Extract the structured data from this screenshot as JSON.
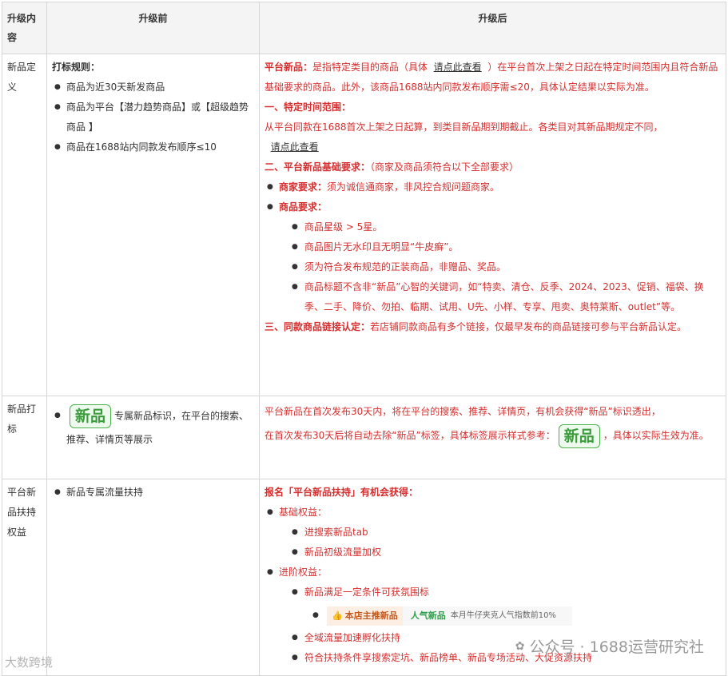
{
  "headers": [
    "升级内容",
    "升级前",
    "升级后"
  ],
  "row1": {
    "label": "新品定义",
    "before": {
      "title": "打标规则：",
      "items": [
        "商品为近30天新发商品",
        "商品为平台【潜力趋势商品】或【超级趋势商品 】",
        "商品在1688站内同款发布顺序≤10"
      ]
    },
    "after": {
      "intro_bold": "平台新品：",
      "intro_a": "是指特定类目的商品（具体",
      "intro_link": "请点此查看",
      "intro_b": "）在平台首次上架之日起在特定时间范围内且符合新品基础要求的商品。此外，该商品1688站内同款发布顺序需≤20，具体认定结果以实际为准。",
      "s1_title": "一、特定时间范围：",
      "s1_text": "从平台同款在1688首次上架之日起算，到类目新品期到期截止。各类目对其新品期规定不同，",
      "s1_link": "请点此查看",
      "s2_title": "二、平台新品基础要求：",
      "s2_note": "（商家及商品须符合以下全部要求）",
      "merchant_label": "商家要求：",
      "merchant_text": "须为诚信通商家，非风控合规问题商家。",
      "product_label": "商品要求：",
      "product_items": [
        "商品星级 > 5星。",
        "商品图片无水印且无明显“牛皮癣”。",
        "须为符合发布规范的正装商品，非赠品、奖品。",
        "商品标题不含非“新品”心智的关键词，如“特卖、清仓、反季、2024、2023、促销、福袋、换季、二手、降价、勿拍、临期、试用、U先、小样、专享、甩卖、奥特莱斯、outlet”等。"
      ],
      "s3_title": "三、同款商品链接认定：",
      "s3_text": "若店铺同款商品有多个链接，仅最早发布的商品链接可参与平台新品认定。"
    }
  },
  "row2": {
    "label": "新品打标",
    "badge": "新品",
    "before_text": "专属新品标识，在平台的搜索、推荐、详情页等展示",
    "after_a": "平台新品在首次发布30天内，将在平台的搜索、推荐、详情页，有机会获得“新品”标识透出，",
    "after_b": "在首次发布30天后将自动去除“新品”标签，具体标签展示样式参考：",
    "after_c": "，具体以实际生效为准。"
  },
  "row3": {
    "label": "平台新品扶持权益",
    "before_item": "新品专属流量扶持",
    "after": {
      "title": "报名「平台新品扶持」有机会获得：",
      "basic_label": "基础权益：",
      "basic_items": [
        "进搜索新品tab",
        "新品初级流量加权"
      ],
      "adv_label": "进阶权益：",
      "adv_item1": "新品满足一定条件可获氛围标",
      "promo_tag": "本店主推新品",
      "promo_pop": "人气新品",
      "promo_desc": "本月牛仔夹克人气指数前10%",
      "adv_item2": "全域流量加速孵化扶持",
      "adv_item3": "符合扶持条件享搜索定坑、新品榜单、新品专场活动、大促资源扶持"
    }
  },
  "watermark": {
    "text": "公众号 · 1688运营研究社",
    "corner": "大数跨境"
  },
  "colors": {
    "accent_red": "#d52f2f",
    "badge_green": "#3a9c3b",
    "border": "#d6d6d6",
    "header_bg": "#f4f4f4"
  }
}
